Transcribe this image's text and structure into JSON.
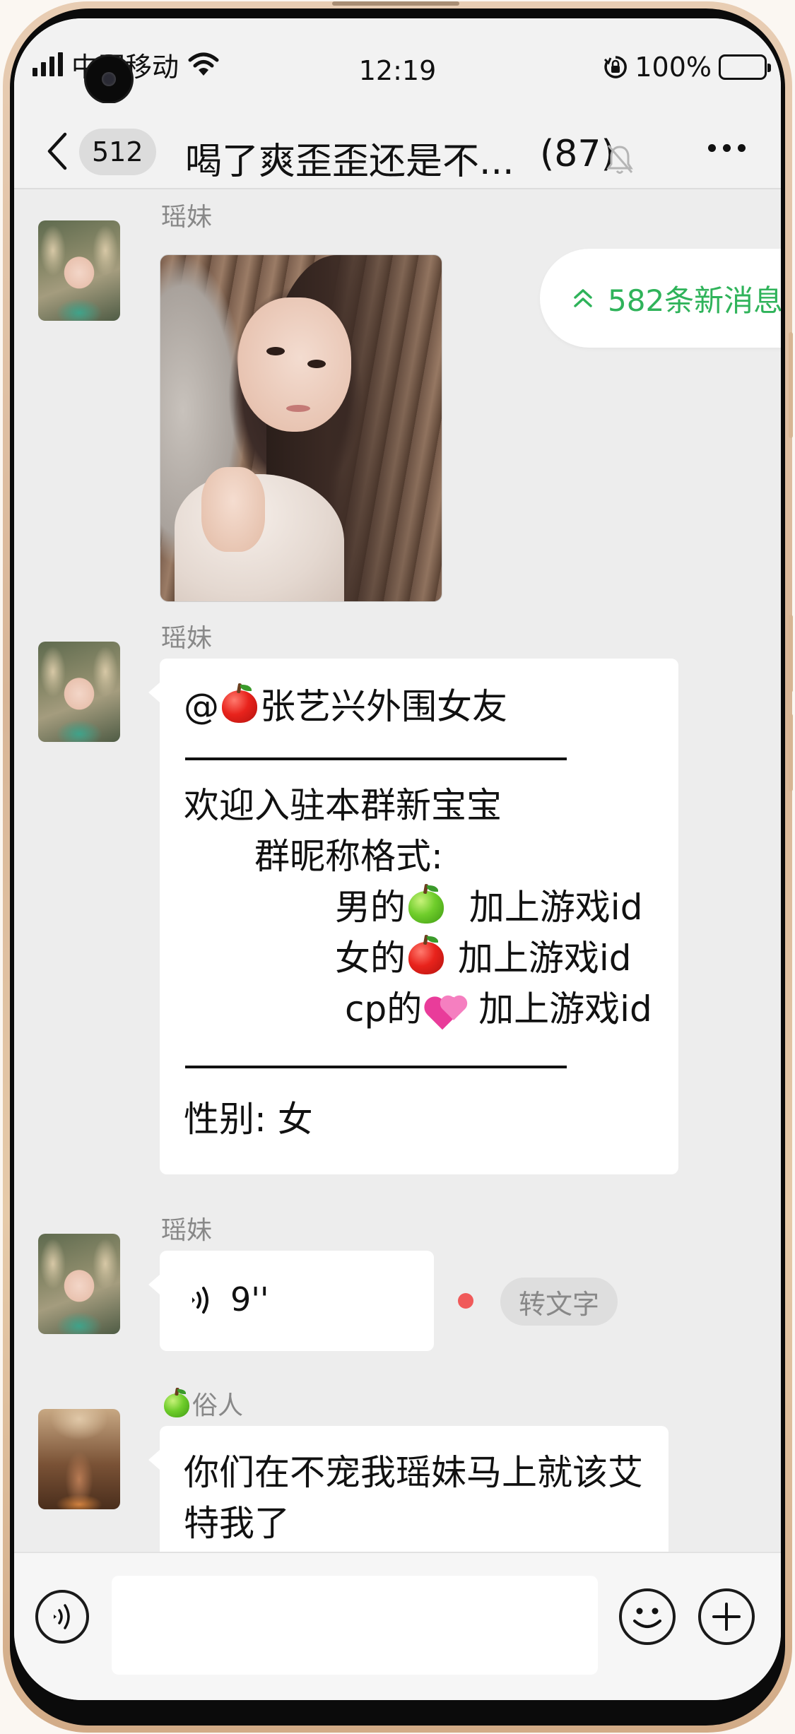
{
  "status_bar": {
    "carrier": "中国移动",
    "time": "12:19",
    "battery": "100%"
  },
  "nav": {
    "unread_count": "512",
    "title": "喝了爽歪歪还是不...",
    "member_count": "(87)"
  },
  "new_messages": {
    "label": "582条新消息"
  },
  "messages": [
    {
      "sender": "瑶妹",
      "type": "image"
    },
    {
      "sender": "瑶妹",
      "type": "text",
      "mention": "@",
      "mention_name": "张艺兴外围女友",
      "welcome": "欢迎入驻本群新宝宝",
      "format_heading": "群昵称格式:",
      "male_label": "男的",
      "female_label": "女的",
      "cp_label": "cp的",
      "suffix": "加上游戏id",
      "gender_line": "性别: 女"
    },
    {
      "sender": "瑶妹",
      "type": "voice",
      "duration": "9''",
      "to_text_label": "转文字"
    },
    {
      "sender": "俗人",
      "type": "text",
      "text_line1": "你们在不宠我瑶妹马上就该艾",
      "text_line2": "特我了"
    }
  ],
  "icons": {
    "red_apple": "red-apple-emoji",
    "green_apple": "green-apple-emoji",
    "hearts": "two-hearts-emoji"
  },
  "colors": {
    "accent_green": "#2fb35a",
    "unread_dot": "#f05a5a",
    "chat_background": "#ededed"
  }
}
